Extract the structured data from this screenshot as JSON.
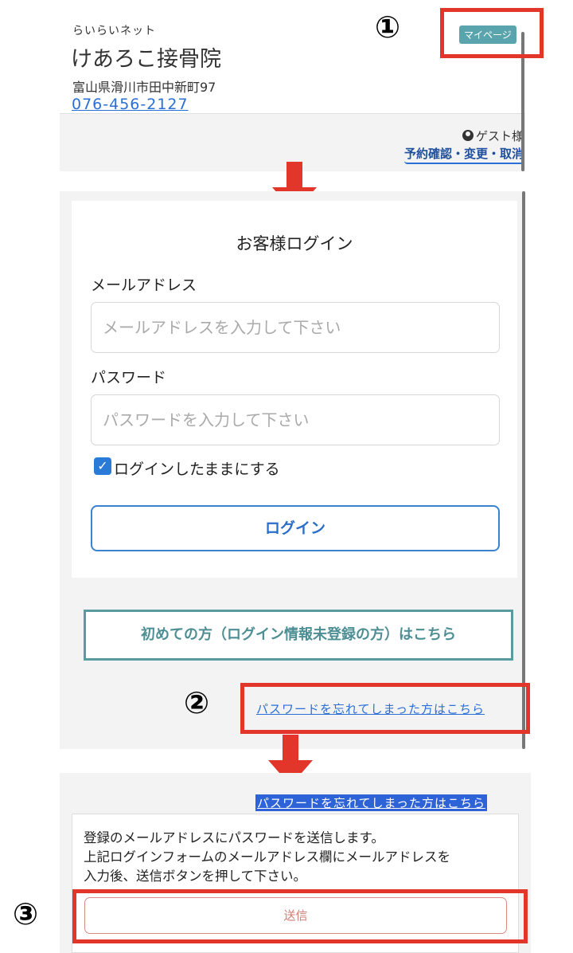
{
  "header": {
    "brand": "らいらいネット",
    "clinic_name": "けあろこ接骨院",
    "address": "富山県滑川市田中新町97",
    "phone": "076-456-2127",
    "mypage_label": "マイページ",
    "guest_label": "ゲスト様",
    "reservation_link": "予約確認・変更・取消"
  },
  "login": {
    "title": "お客様ログイン",
    "email_label": "メールアドレス",
    "email_placeholder": "メールアドレスを入力して下さい",
    "password_label": "パスワード",
    "password_placeholder": "パスワードを入力して下さい",
    "remember_label": "ログインしたままにする",
    "remember_checked": true,
    "login_button": "ログイン",
    "first_time_button": "初めての方（ログイン情報未登録の方）はこちら",
    "forgot_link": "パスワードを忘れてしまった方はこちら"
  },
  "reset": {
    "forgot_link": "パスワードを忘れてしまった方はこちら",
    "message_line1": "登録のメールアドレスにパスワードを送信します。",
    "message_line2": "上記ログインフォームのメールアドレス欄にメールアドレスを",
    "message_line3": "入力後、送信ボタンを押して下さい。",
    "send_button": "送信"
  },
  "annotations": {
    "step1": "①",
    "step2": "②",
    "step3": "③"
  },
  "colors": {
    "annotation_red": "#e3362b",
    "link_blue": "#2a6fd6",
    "teal": "#5aa5ad"
  }
}
